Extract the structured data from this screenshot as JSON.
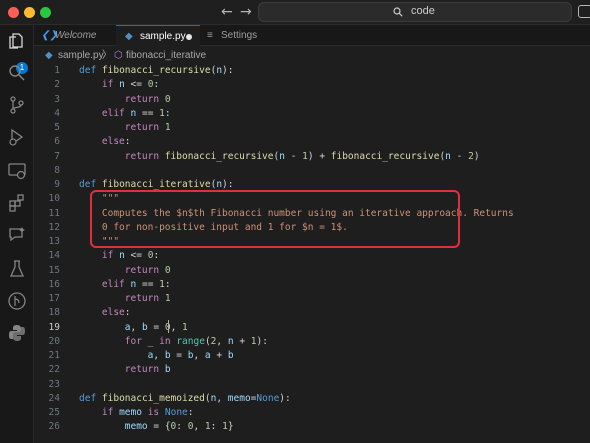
{
  "titlebar": {
    "search_label": "code",
    "back": "←",
    "forward": "→"
  },
  "activity": {
    "explorer_badge": "1"
  },
  "tabs": [
    {
      "label": "Welcome",
      "icon": "vscode-logo-icon"
    },
    {
      "label": "sample.py",
      "icon": "python-file-icon",
      "modified": true
    },
    {
      "label": "Settings",
      "icon": "settings-icon"
    }
  ],
  "breadcrumb": {
    "file": "sample.py",
    "separator": "〉",
    "symbol": "fibonacci_iterative"
  },
  "editor": {
    "line_numbers": [
      "1",
      "2",
      "3",
      "4",
      "5",
      "6",
      "7",
      "8",
      "9",
      "10",
      "11",
      "12",
      "13",
      "14",
      "15",
      "16",
      "17",
      "18",
      "19",
      "20",
      "21",
      "22",
      "23",
      "24",
      "25",
      "26"
    ],
    "active_line": "19",
    "lines": [
      "def fibonacci_recursive(n):",
      "    if n <= 0:",
      "        return 0",
      "    elif n == 1:",
      "        return 1",
      "    else:",
      "        return fibonacci_recursive(n - 1) + fibonacci_recursive(n - 2)",
      "",
      "def fibonacci_iterative(n):",
      "    \"\"\"",
      "    Computes the $n$th Fibonacci number using an iterative approach. Returns",
      "    0 for non-positive input and 1 for $n = 1$.",
      "    \"\"\"",
      "    if n <= 0:",
      "        return 0",
      "    elif n == 1:",
      "        return 1",
      "    else:",
      "        a, b = 0, 1",
      "        for _ in range(2, n + 1):",
      "            a, b = b, a + b",
      "        return b",
      "",
      "def fibonacci_memoized(n, memo=None):",
      "    if memo is None:",
      "        memo = {0: 0, 1: 1}"
    ]
  },
  "colors": {
    "keyword": "#c586c0",
    "def": "#569cd6",
    "function": "#dcdcaa",
    "number": "#b5cea8",
    "string": "#ce9178",
    "param": "#9cdcfe",
    "highlight_box": "#e0303d"
  }
}
